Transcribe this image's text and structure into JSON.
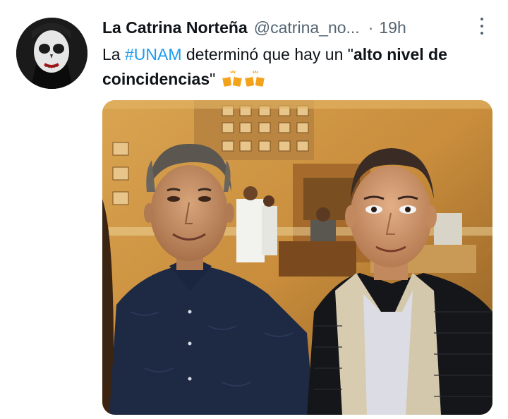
{
  "tweet": {
    "display_name": "La Catrina Norteña",
    "handle": "@catrina_no...",
    "separator": "·",
    "time": "19h",
    "text_part1": "La ",
    "hashtag": "#UNAM",
    "text_part2": " determinó que hay un \"",
    "bold_text": "alto nivel de coincidencias",
    "text_part3": "\"",
    "emojis": [
      "clinking-beer-mugs-icon",
      "clinking-beer-mugs-icon"
    ]
  },
  "colors": {
    "link": "#1d9bf0",
    "secondary_text": "#536471",
    "primary_text": "#0f1419"
  }
}
